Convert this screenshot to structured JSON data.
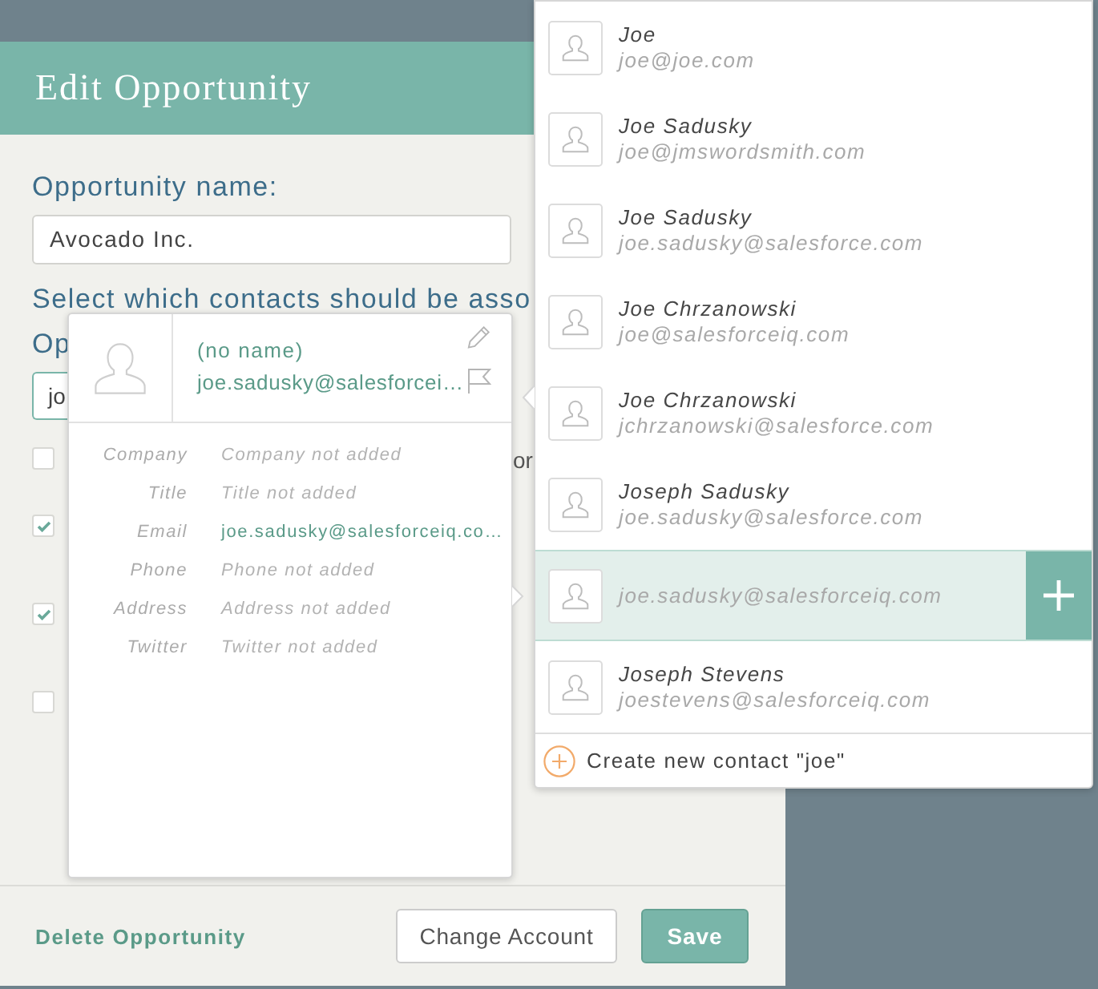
{
  "dialog": {
    "title": "Edit Opportunity",
    "name_field": {
      "label": "Opportunity name:",
      "value": "Avocado Inc."
    },
    "contacts_prompt": [
      "Select which contacts should be asso",
      "Op"
    ],
    "contact_search": {
      "value": "jo"
    },
    "contact_rows": [
      {
        "checked": false,
        "text": "or"
      },
      {
        "checked": true
      },
      {
        "checked": true
      },
      {
        "checked": false
      }
    ],
    "delete_link": "Delete Opportunity",
    "buttons": [
      {
        "label": "Change Account",
        "kind": "outline"
      },
      {
        "label": "Save",
        "kind": "filled"
      }
    ]
  },
  "contact_card": {
    "name": "(no name)",
    "email": "joe.sadusky@salesforcei…",
    "details": [
      {
        "label": "Company",
        "value": "Company not added",
        "kind": "empty"
      },
      {
        "label": "Title",
        "value": "Title not added",
        "kind": "empty"
      },
      {
        "label": "Email",
        "value": "joe.sadusky@salesforceiq.co…",
        "kind": "link"
      },
      {
        "label": "Phone",
        "value": "Phone not added",
        "kind": "empty"
      },
      {
        "label": "Address",
        "value": "Address not added",
        "kind": "empty"
      },
      {
        "label": "Twitter",
        "value": "Twitter not added",
        "kind": "empty"
      }
    ]
  },
  "suggestions": {
    "items": [
      {
        "name": "Joe",
        "email": "joe@joe.com",
        "selected": false
      },
      {
        "name": "Joe Sadusky",
        "email": "joe@jmswordsmith.com",
        "selected": false
      },
      {
        "name": "Joe Sadusky",
        "email": "joe.sadusky@salesforce.com",
        "selected": false
      },
      {
        "name": "Joe Chrzanowski",
        "email": "joe@salesforceiq.com",
        "selected": false
      },
      {
        "name": "Joe Chrzanowski",
        "email": "jchrzanowski@salesforce.com",
        "selected": false
      },
      {
        "name": "Joseph Sadusky",
        "email": "joe.sadusky@salesforce.com",
        "selected": false
      },
      {
        "email": "joe.sadusky@salesforceiq.com",
        "selected": true
      },
      {
        "name": "Joseph Stevens",
        "email": "joestevens@salesforceiq.com",
        "selected": false
      }
    ],
    "create_option": "Create new contact \"joe\""
  }
}
